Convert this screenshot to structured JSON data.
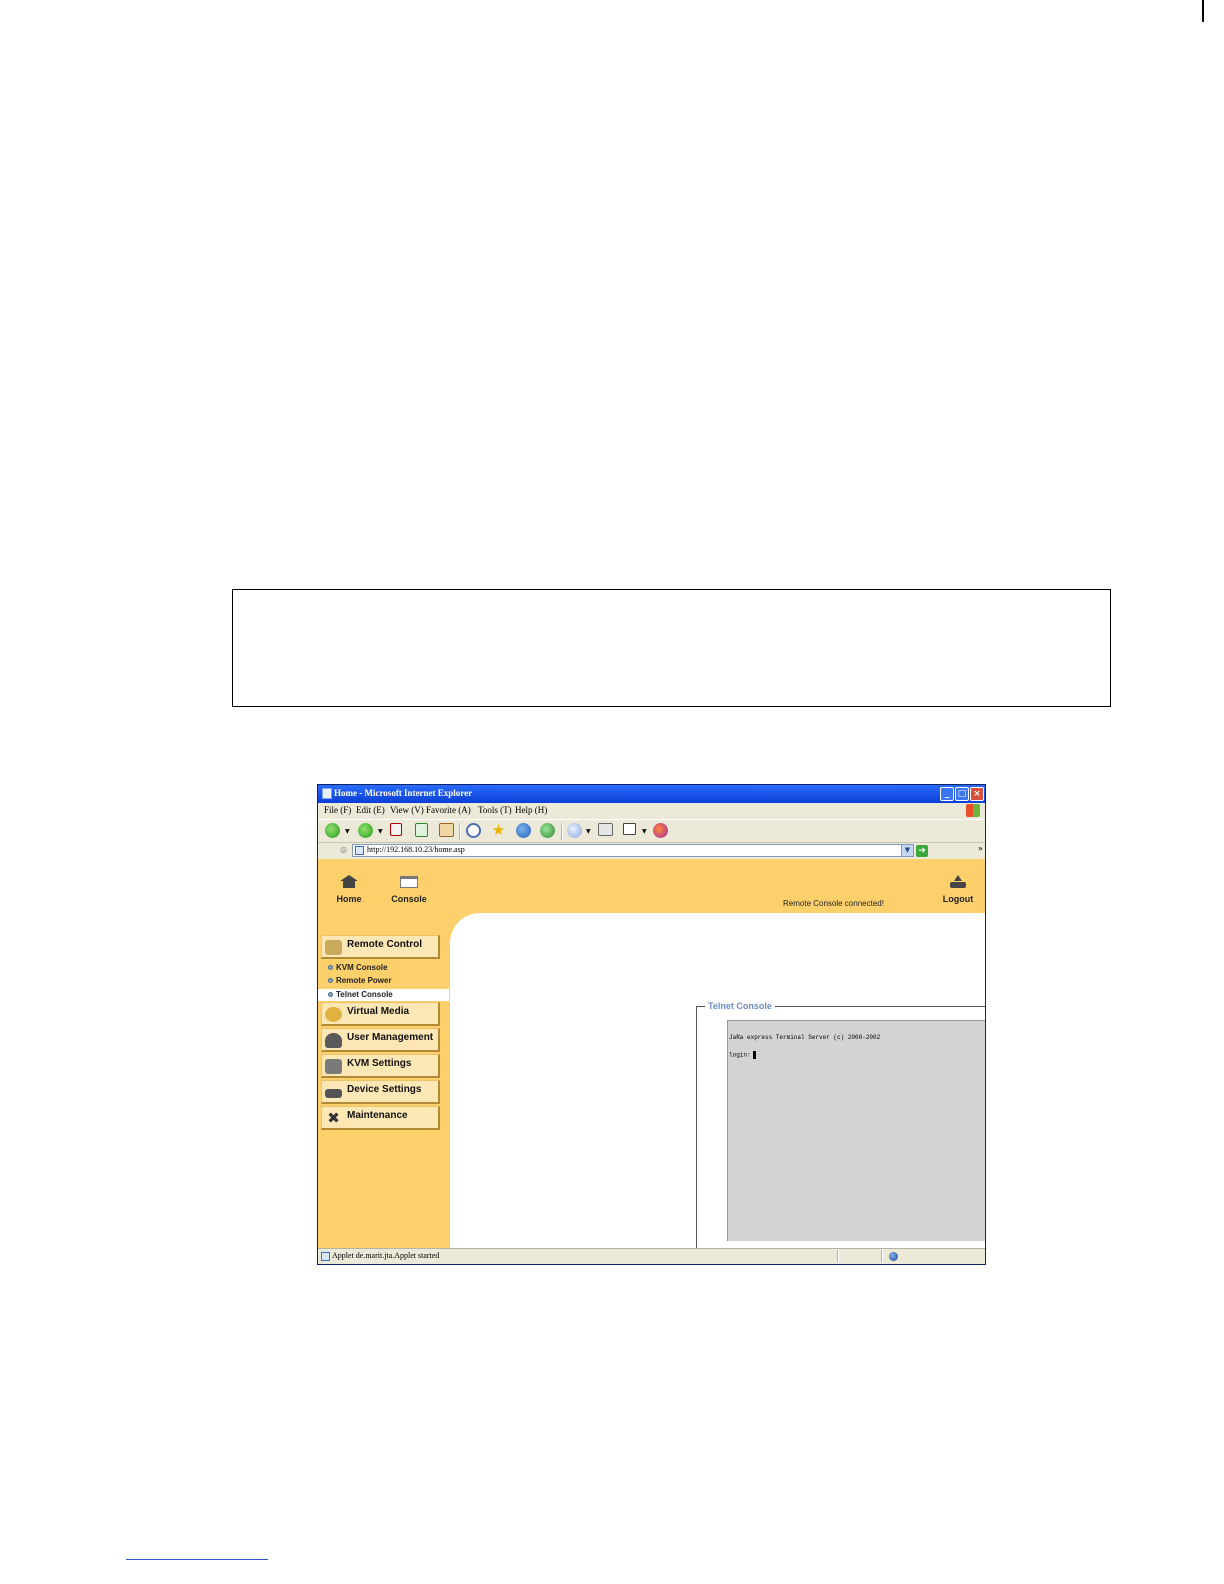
{
  "browser": {
    "title": "Home - Microsoft Internet Explorer",
    "menu": [
      "File (F)",
      "Edit (E)",
      "View (V)",
      "Favorite (A)",
      "Tools (T)",
      "Help (H)"
    ],
    "address": "http://192.168.10.23/home.asp",
    "status": "Applet de.marit.jta.Applet started"
  },
  "topnav": {
    "home": "Home",
    "console": "Console",
    "logout": "Logout",
    "status_message": "Remote Console connected!"
  },
  "sidebar": {
    "remote_control": "Remote Control",
    "submenu": [
      "KVM Console",
      "Remote Power",
      "Telnet Console"
    ],
    "virtual_media": "Virtual Media",
    "user_management": "User Management",
    "kvm_settings": "KVM Settings",
    "device_settings": "Device Settings",
    "maintenance": "Maintenance"
  },
  "telnet": {
    "legend": "Telnet Console",
    "line1": "JaRa express Terminal Server (c) 2000-2002",
    "line2": "login:"
  },
  "colors": {
    "app_background": "#fdd06c",
    "legend_color": "#6b8cc7",
    "terminal_bg": "#d3d3d3",
    "titlebar": "#0a3fd6"
  }
}
